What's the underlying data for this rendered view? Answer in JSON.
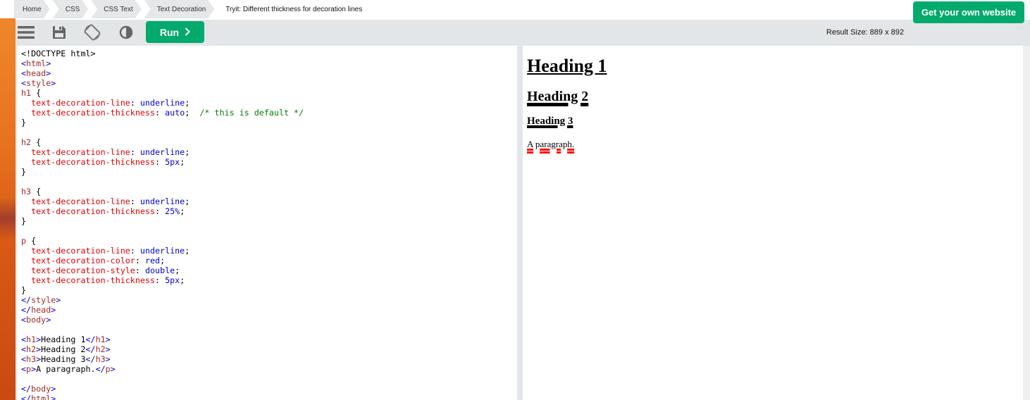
{
  "breadcrumb": {
    "items": [
      "Home",
      "CSS",
      "CSS Text",
      "Text Decoration"
    ],
    "current": "Tryit: Different thickness for decoration lines"
  },
  "toolbar": {
    "icons": [
      "menu-icon",
      "save-icon",
      "rotate-icon",
      "contrast-icon"
    ],
    "run_label": "Run",
    "result_size": "Result Size: 889 x 892",
    "own_site_label": "Get your own website"
  },
  "colors": {
    "accent_green": "#04aa6d",
    "toolbar_bg": "#e3e6e8"
  },
  "code_lines": [
    [
      {
        "t": "<!DOCTYPE html>",
        "c": "plain"
      }
    ],
    [
      {
        "t": "<",
        "c": "tag"
      },
      {
        "t": "html",
        "c": "tn"
      },
      {
        "t": ">",
        "c": "tag"
      }
    ],
    [
      {
        "t": "<",
        "c": "tag"
      },
      {
        "t": "head",
        "c": "tn"
      },
      {
        "t": ">",
        "c": "tag"
      }
    ],
    [
      {
        "t": "<",
        "c": "tag"
      },
      {
        "t": "style",
        "c": "tn"
      },
      {
        "t": ">",
        "c": "tag"
      }
    ],
    [
      {
        "t": "h1 ",
        "c": "sel"
      },
      {
        "t": "{",
        "c": "plain"
      }
    ],
    [
      {
        "t": "  ",
        "c": "plain"
      },
      {
        "t": "text-decoration-line",
        "c": "prop"
      },
      {
        "t": ": ",
        "c": "plain"
      },
      {
        "t": "underline",
        "c": "val"
      },
      {
        "t": ";",
        "c": "plain"
      }
    ],
    [
      {
        "t": "  ",
        "c": "plain"
      },
      {
        "t": "text-decoration-thickness",
        "c": "prop"
      },
      {
        "t": ": ",
        "c": "plain"
      },
      {
        "t": "auto",
        "c": "val"
      },
      {
        "t": ";  ",
        "c": "plain"
      },
      {
        "t": "/* this is default */",
        "c": "cmt"
      }
    ],
    [
      {
        "t": "}",
        "c": "plain"
      }
    ],
    [
      {
        "t": "",
        "c": "plain"
      }
    ],
    [
      {
        "t": "h2 ",
        "c": "sel"
      },
      {
        "t": "{",
        "c": "plain"
      }
    ],
    [
      {
        "t": "  ",
        "c": "plain"
      },
      {
        "t": "text-decoration-line",
        "c": "prop"
      },
      {
        "t": ": ",
        "c": "plain"
      },
      {
        "t": "underline",
        "c": "val"
      },
      {
        "t": ";",
        "c": "plain"
      }
    ],
    [
      {
        "t": "  ",
        "c": "plain"
      },
      {
        "t": "text-decoration-thickness",
        "c": "prop"
      },
      {
        "t": ": ",
        "c": "plain"
      },
      {
        "t": "5px",
        "c": "val"
      },
      {
        "t": ";",
        "c": "plain"
      }
    ],
    [
      {
        "t": "}",
        "c": "plain"
      }
    ],
    [
      {
        "t": "",
        "c": "plain"
      }
    ],
    [
      {
        "t": "h3 ",
        "c": "sel"
      },
      {
        "t": "{",
        "c": "plain"
      }
    ],
    [
      {
        "t": "  ",
        "c": "plain"
      },
      {
        "t": "text-decoration-line",
        "c": "prop"
      },
      {
        "t": ": ",
        "c": "plain"
      },
      {
        "t": "underline",
        "c": "val"
      },
      {
        "t": ";",
        "c": "plain"
      }
    ],
    [
      {
        "t": "  ",
        "c": "plain"
      },
      {
        "t": "text-decoration-thickness",
        "c": "prop"
      },
      {
        "t": ": ",
        "c": "plain"
      },
      {
        "t": "25%",
        "c": "val"
      },
      {
        "t": ";",
        "c": "plain"
      }
    ],
    [
      {
        "t": "}",
        "c": "plain"
      }
    ],
    [
      {
        "t": "",
        "c": "plain"
      }
    ],
    [
      {
        "t": "p ",
        "c": "sel"
      },
      {
        "t": "{",
        "c": "plain"
      }
    ],
    [
      {
        "t": "  ",
        "c": "plain"
      },
      {
        "t": "text-decoration-line",
        "c": "prop"
      },
      {
        "t": ": ",
        "c": "plain"
      },
      {
        "t": "underline",
        "c": "val"
      },
      {
        "t": ";",
        "c": "plain"
      }
    ],
    [
      {
        "t": "  ",
        "c": "plain"
      },
      {
        "t": "text-decoration-color",
        "c": "prop"
      },
      {
        "t": ": ",
        "c": "plain"
      },
      {
        "t": "red",
        "c": "val"
      },
      {
        "t": ";",
        "c": "plain"
      }
    ],
    [
      {
        "t": "  ",
        "c": "plain"
      },
      {
        "t": "text-decoration-style",
        "c": "prop"
      },
      {
        "t": ": ",
        "c": "plain"
      },
      {
        "t": "double",
        "c": "val"
      },
      {
        "t": ";",
        "c": "plain"
      }
    ],
    [
      {
        "t": "  ",
        "c": "plain"
      },
      {
        "t": "text-decoration-thickness",
        "c": "prop"
      },
      {
        "t": ": ",
        "c": "plain"
      },
      {
        "t": "5px",
        "c": "val"
      },
      {
        "t": ";",
        "c": "plain"
      }
    ],
    [
      {
        "t": "}",
        "c": "plain"
      }
    ],
    [
      {
        "t": "</",
        "c": "tag"
      },
      {
        "t": "style",
        "c": "tn"
      },
      {
        "t": ">",
        "c": "tag"
      }
    ],
    [
      {
        "t": "</",
        "c": "tag"
      },
      {
        "t": "head",
        "c": "tn"
      },
      {
        "t": ">",
        "c": "tag"
      }
    ],
    [
      {
        "t": "<",
        "c": "tag"
      },
      {
        "t": "body",
        "c": "tn"
      },
      {
        "t": ">",
        "c": "tag"
      }
    ],
    [
      {
        "t": "",
        "c": "plain"
      }
    ],
    [
      {
        "t": "<",
        "c": "tag"
      },
      {
        "t": "h1",
        "c": "tn"
      },
      {
        "t": ">",
        "c": "tag"
      },
      {
        "t": "Heading 1",
        "c": "plain"
      },
      {
        "t": "</",
        "c": "tag"
      },
      {
        "t": "h1",
        "c": "tn"
      },
      {
        "t": ">",
        "c": "tag"
      }
    ],
    [
      {
        "t": "<",
        "c": "tag"
      },
      {
        "t": "h2",
        "c": "tn"
      },
      {
        "t": ">",
        "c": "tag"
      },
      {
        "t": "Heading 2",
        "c": "plain"
      },
      {
        "t": "</",
        "c": "tag"
      },
      {
        "t": "h2",
        "c": "tn"
      },
      {
        "t": ">",
        "c": "tag"
      }
    ],
    [
      {
        "t": "<",
        "c": "tag"
      },
      {
        "t": "h3",
        "c": "tn"
      },
      {
        "t": ">",
        "c": "tag"
      },
      {
        "t": "Heading 3",
        "c": "plain"
      },
      {
        "t": "</",
        "c": "tag"
      },
      {
        "t": "h3",
        "c": "tn"
      },
      {
        "t": ">",
        "c": "tag"
      }
    ],
    [
      {
        "t": "<",
        "c": "tag"
      },
      {
        "t": "p",
        "c": "tn"
      },
      {
        "t": ">",
        "c": "tag"
      },
      {
        "t": "A paragraph.",
        "c": "plain"
      },
      {
        "t": "</",
        "c": "tag"
      },
      {
        "t": "p",
        "c": "tn"
      },
      {
        "t": ">",
        "c": "tag"
      }
    ],
    [
      {
        "t": "",
        "c": "plain"
      }
    ],
    [
      {
        "t": "</",
        "c": "tag"
      },
      {
        "t": "body",
        "c": "tn"
      },
      {
        "t": ">",
        "c": "tag"
      }
    ],
    [
      {
        "t": "</",
        "c": "tag"
      },
      {
        "t": "html",
        "c": "tn"
      },
      {
        "t": ">",
        "c": "tag"
      }
    ]
  ],
  "result": {
    "h1": "Heading 1",
    "h2": "Heading 2",
    "h3": "Heading 3",
    "p": "A paragraph."
  }
}
